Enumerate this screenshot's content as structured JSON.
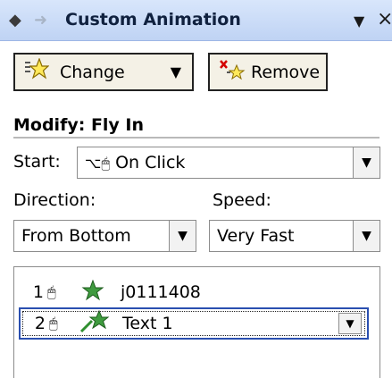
{
  "titlebar": {
    "title": "Custom Animation",
    "back_icon": "◆",
    "forward_icon": "➜",
    "menu_icon": "▼",
    "close_icon": "×"
  },
  "toolbar": {
    "change_label": "Change",
    "change_caret": "▼",
    "remove_label": "Remove"
  },
  "modify": {
    "heading": "Modify: Fly In",
    "start_label": "Start:",
    "start_value": "On Click",
    "direction_label": "Direction:",
    "direction_value": "From Bottom",
    "speed_label": "Speed:",
    "speed_value": "Very Fast",
    "dropdown_arrow": "▼"
  },
  "list": {
    "items": [
      {
        "number": "1",
        "name": "j0111408"
      },
      {
        "number": "2",
        "name": "Text 1"
      }
    ]
  }
}
